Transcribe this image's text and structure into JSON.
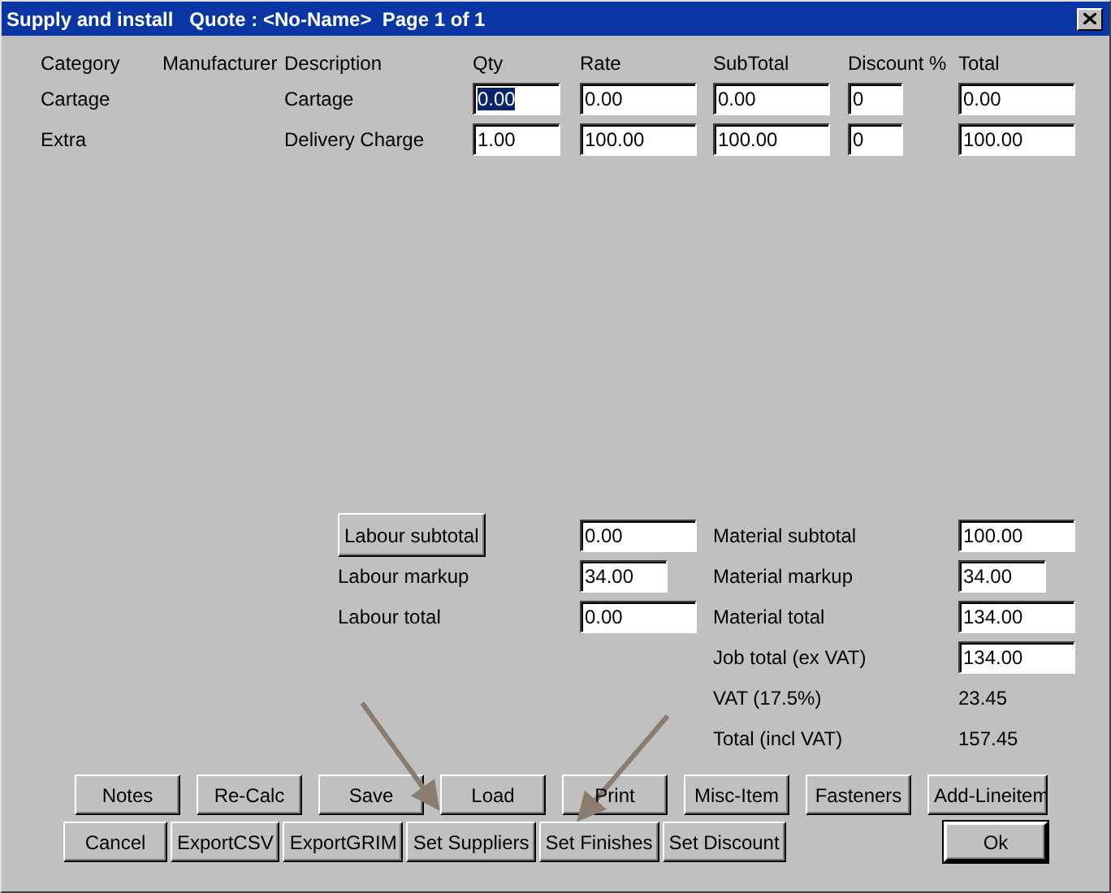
{
  "window": {
    "title": "Supply and install   Quote : <No-Name>  Page 1 of 1"
  },
  "table": {
    "columns": [
      "Category",
      "Manufacturer",
      "Description",
      "Qty",
      "Rate",
      "SubTotal",
      "Discount %",
      "Total"
    ],
    "rows": [
      {
        "category": "Cartage",
        "description": "Cartage",
        "fields": [
          {
            "value": "0.00",
            "selected": true
          },
          {
            "value": "0.00",
            "selected": false
          },
          {
            "value": "0.00",
            "selected": false
          },
          {
            "value": "0",
            "selected": false
          },
          {
            "value": "0.00",
            "selected": false
          }
        ]
      },
      {
        "category": "Extra",
        "description": "Delivery Charge",
        "fields": [
          {
            "value": "1.00",
            "selected": false
          },
          {
            "value": "100.00",
            "selected": false
          },
          {
            "value": "100.00",
            "selected": false
          },
          {
            "value": "0",
            "selected": false
          },
          {
            "value": "100.00",
            "selected": false
          }
        ]
      }
    ]
  },
  "labour": [
    {
      "kind": "button",
      "label": "Labour subtotal",
      "field": {
        "kind": "field",
        "value": "0.00"
      }
    },
    {
      "kind": "text",
      "label": "Labour markup",
      "field": {
        "kind": "short-field",
        "value": "34.00"
      }
    },
    {
      "kind": "text",
      "label": "Labour total",
      "field": {
        "kind": "field",
        "value": "0.00"
      }
    }
  ],
  "material": [
    {
      "label": "Material subtotal",
      "kind": "field",
      "value": "100.00"
    },
    {
      "label": "Material markup",
      "kind": "short-field",
      "value": "34.00"
    },
    {
      "label": "Material total",
      "kind": "field",
      "value": "134.00"
    },
    {
      "label": "Job total (ex VAT)",
      "kind": "field",
      "value": "134.00"
    },
    {
      "label": "VAT (17.5%)",
      "kind": "text",
      "value": "23.45"
    },
    {
      "label": "Total (incl VAT)",
      "kind": "text",
      "value": "157.45"
    }
  ],
  "button_rows": [
    [
      {
        "label": "Notes",
        "default": false
      },
      {
        "label": "Re-Calc",
        "default": false
      },
      {
        "label": "Save",
        "default": false
      },
      {
        "label": "Load",
        "default": false
      },
      {
        "label": "Print",
        "default": false
      },
      {
        "label": "Misc-Item",
        "default": false
      },
      {
        "label": "Fasteners",
        "default": false
      },
      {
        "label": "Add-Lineitem",
        "default": false
      }
    ],
    [
      {
        "label": "Cancel",
        "default": false
      },
      {
        "label": "ExportCSV",
        "default": false
      },
      {
        "label": "ExportGRIM",
        "default": false
      },
      {
        "label": "Set Suppliers",
        "default": false
      },
      {
        "label": "Set Finishes",
        "default": false
      },
      {
        "label": "Set Discount",
        "default": false
      },
      {
        "label": "Ok",
        "default": true
      }
    ]
  ]
}
